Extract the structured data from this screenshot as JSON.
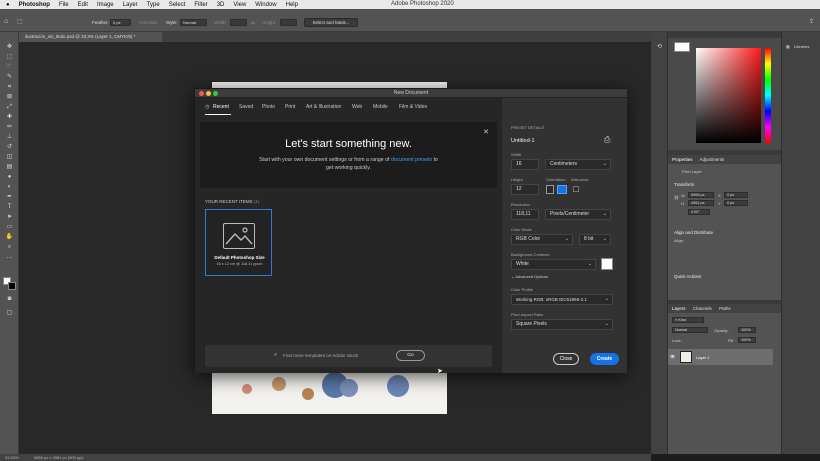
{
  "menubar": {
    "app_name": "Photoshop",
    "items": [
      "File",
      "Edit",
      "Image",
      "Layer",
      "Type",
      "Select",
      "Filter",
      "3D",
      "View",
      "Window",
      "Help"
    ],
    "window_title": "Adobe Photoshop 2020"
  },
  "options_bar": {
    "feather_label": "Feather:",
    "feather_value": "0 px",
    "antialias_label": "Anti-alias",
    "style_label": "Style:",
    "style_value": "Normal",
    "width_label": "Width:",
    "height_label": "Height:",
    "select_mask_label": "Select and Mask..."
  },
  "document_tab": {
    "title": "ilustración_sin_titulo.psd @ 33,3% (Layer 1, CMYK/8) *"
  },
  "status_bar": {
    "zoom": "33,33%",
    "doc_info": "5669 px x 4961 px (300 ppi)"
  },
  "dialog": {
    "title": "New Document",
    "tabs": [
      "Recent",
      "Saved",
      "Photo",
      "Print",
      "Art & Illustration",
      "Web",
      "Mobile",
      "Film & Video"
    ],
    "active_tab": "Recent",
    "hero_title": "Let's start something new.",
    "hero_sub_1": "Start with your own document settings or from a range of",
    "hero_link": "document presets",
    "hero_sub_2": "to",
    "hero_sub_3": "get working quickly.",
    "recent_label": "YOUR RECENT ITEMS",
    "recent_count": "(1)",
    "recent_item_name": "Default Photoshop Size",
    "recent_item_meta": "16 x 12 cm @ 118,11 ppcm",
    "search_placeholder": "Find more templates on Adobe Stock",
    "go_label": "Go",
    "preset_details_label": "PRESET DETAILS",
    "doc_name": "Untitled-1",
    "width_label": "Width",
    "width_value": "16",
    "width_unit": "Centimeters",
    "height_label": "Height",
    "height_value": "12",
    "orientation_label": "Orientation",
    "artboards_label": "Artboards",
    "resolution_label": "Resolution",
    "resolution_value": "118,11",
    "resolution_unit": "Pixels/Centimeter",
    "color_mode_label": "Color Mode",
    "color_mode_value": "RGB Color",
    "bit_depth": "8 bit",
    "bg_contents_label": "Background Contents",
    "bg_contents_value": "White",
    "advanced_label": "Advanced Options",
    "color_profile_label": "Color Profile",
    "color_profile_value": "Working RGB: sRGB IEC61966-2.1",
    "pixel_aspect_label": "Pixel Aspect Ratio",
    "pixel_aspect_value": "Square Pixels",
    "close_label": "Close",
    "create_label": "Create"
  },
  "panels": {
    "libraries_label": "Libraries",
    "properties_tab": "Properties",
    "adjustments_tab": "Adjustments",
    "pixel_layer": "Pixel Layer",
    "transform_label": "Transform",
    "w_label": "W",
    "w_value": "5906 px",
    "h_label": "H",
    "h_value": "4961 px",
    "x_label": "X",
    "x_value": "0 px",
    "y_label": "Y",
    "y_value": "0 px",
    "angle_value": "0,00°",
    "align_label": "Align and Distribute",
    "align_sub": "Align:",
    "quick_actions_label": "Quick Actions",
    "layers_tab": "Layers",
    "channels_tab": "Channels",
    "paths_tab": "Paths",
    "kind_label": "Kind",
    "blend_mode": "Normal",
    "opacity_label": "Opacity:",
    "opacity_value": "100%",
    "lock_label": "Lock:",
    "fill_label": "Fill:",
    "fill_value": "100%",
    "layer_name": "Layer 1"
  },
  "colors": {
    "accent_blue": "#1473e6",
    "link_blue": "#4b9cf4",
    "panel_gray": "#535353"
  }
}
